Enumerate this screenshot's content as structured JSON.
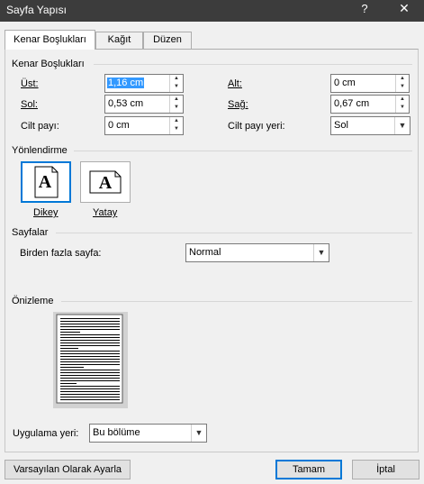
{
  "window": {
    "title": "Sayfa Yapısı",
    "help": "?",
    "close": "✕"
  },
  "tabs": [
    "Kenar Boşlukları",
    "Kağıt",
    "Düzen"
  ],
  "margins": {
    "group_title": "Kenar Boşlukları",
    "top_label": "Üst:",
    "top_value": "1,16 cm",
    "bottom_label": "Alt:",
    "bottom_value": "0 cm",
    "left_label": "Sol:",
    "left_value": "0,53 cm",
    "right_label": "Sağ:",
    "right_value": "0,67 cm",
    "gutter_label": "Cilt payı:",
    "gutter_value": "0 cm",
    "gutter_pos_label": "Cilt payı yeri:",
    "gutter_pos_value": "Sol"
  },
  "orientation": {
    "group_title": "Yönlendirme",
    "portrait": "Dikey",
    "landscape": "Yatay",
    "glyph": "A"
  },
  "pages": {
    "group_title": "Sayfalar",
    "multiple_label": "Birden fazla sayfa:",
    "multiple_value": "Normal"
  },
  "preview": {
    "group_title": "Önizleme"
  },
  "apply": {
    "label": "Uygulama yeri:",
    "value": "Bu bölüme"
  },
  "buttons": {
    "set_default": "Varsayılan Olarak Ayarla",
    "ok": "Tamam",
    "cancel": "İptal"
  },
  "colors": {
    "titlebar": "#3c3c3c",
    "accent": "#0078d7",
    "selection": "#3399ff"
  }
}
